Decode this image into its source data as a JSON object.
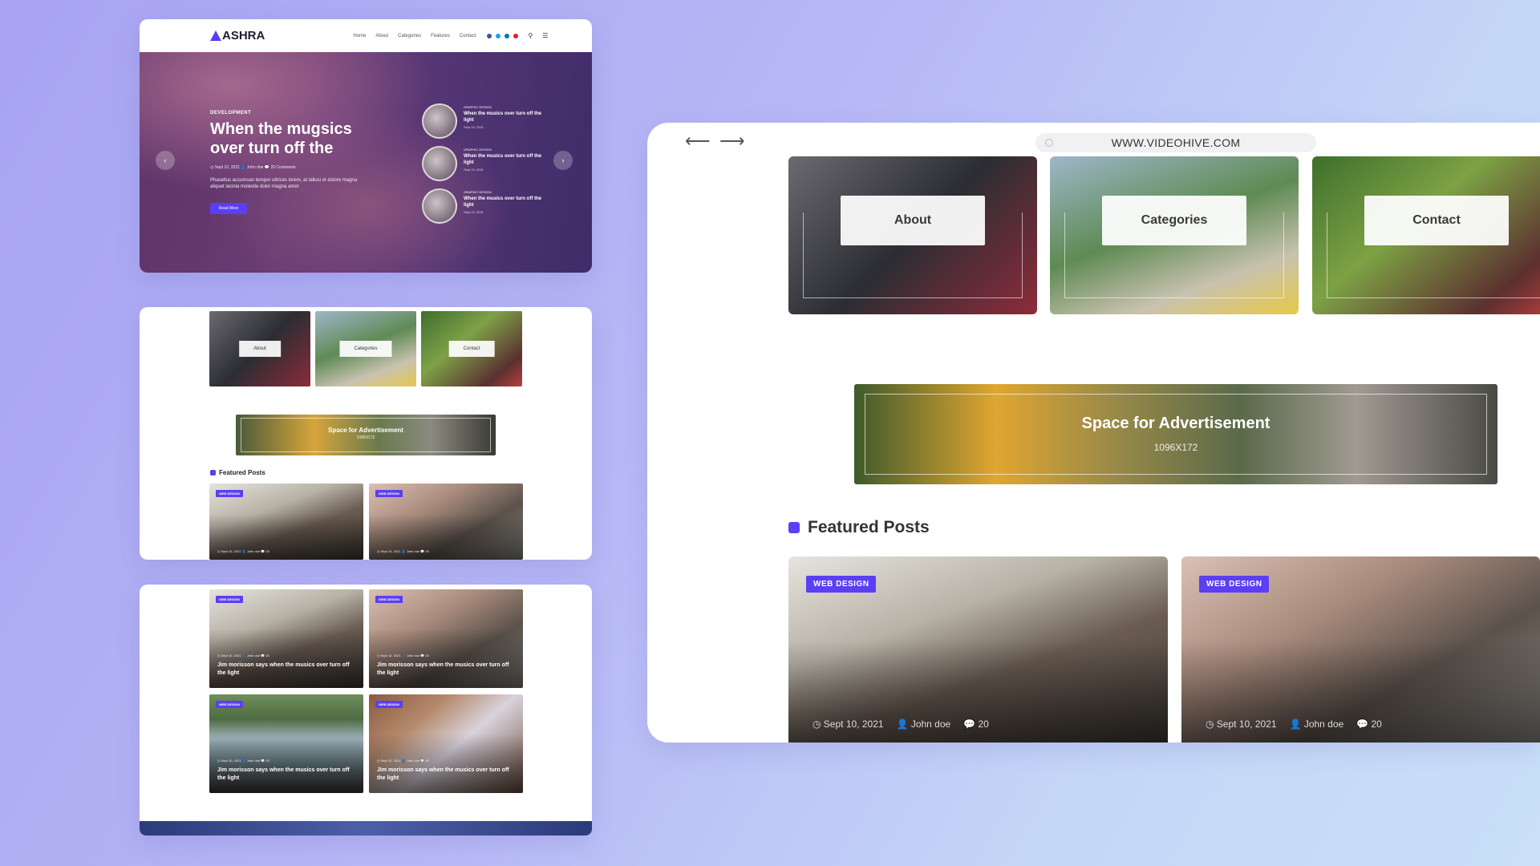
{
  "site": {
    "logo": "ASHRA",
    "nav": [
      "Home",
      "About",
      "Categories",
      "Features",
      "Contact"
    ],
    "social_colors": [
      "#3b5998",
      "#1da1f2",
      "#0077b5",
      "#e62117"
    ]
  },
  "hero": {
    "category": "DEVELOPMENT",
    "title": "When the mugsics over turn off the",
    "meta": "◷ Sept 10, 2021   👤 John doe   💬 20 Comments",
    "excerpt": "Phasellus accumsan tempor ultrices lorem, at tallusi et dolore magna aliquet lacinia molestie dolor magna amet",
    "button": "Read More",
    "side_posts": [
      {
        "category": "GRAPHIC DESIGN",
        "title": "When the musics over turn off the light",
        "date": "Sept 10, 2021"
      },
      {
        "category": "GRAPHIC DESIGN",
        "title": "When the musics over turn off the light",
        "date": "Sept 10, 2021"
      },
      {
        "category": "GRAPHIC DESIGN",
        "title": "When the musics over turn off the light",
        "date": "Sept 10, 2021"
      }
    ]
  },
  "categories": [
    "About",
    "Categories",
    "Contact"
  ],
  "ad": {
    "title": "Space for Advertisement",
    "size": "1096X172"
  },
  "featured": {
    "heading": "Featured Posts",
    "badge": "WEB DESIGN",
    "meta": "◷ Sept 10, 2021   👤 John doe   💬 20",
    "post_title": "Jim morisson says when the musics over turn off the light"
  },
  "browser": {
    "url": "WWW.VIDEOHIVE.COM",
    "meta_date": "◷ Sept 10, 2021",
    "meta_author": "👤 John doe",
    "meta_comments": "💬 20"
  },
  "colors": {
    "accent": "#5b3ff2"
  }
}
